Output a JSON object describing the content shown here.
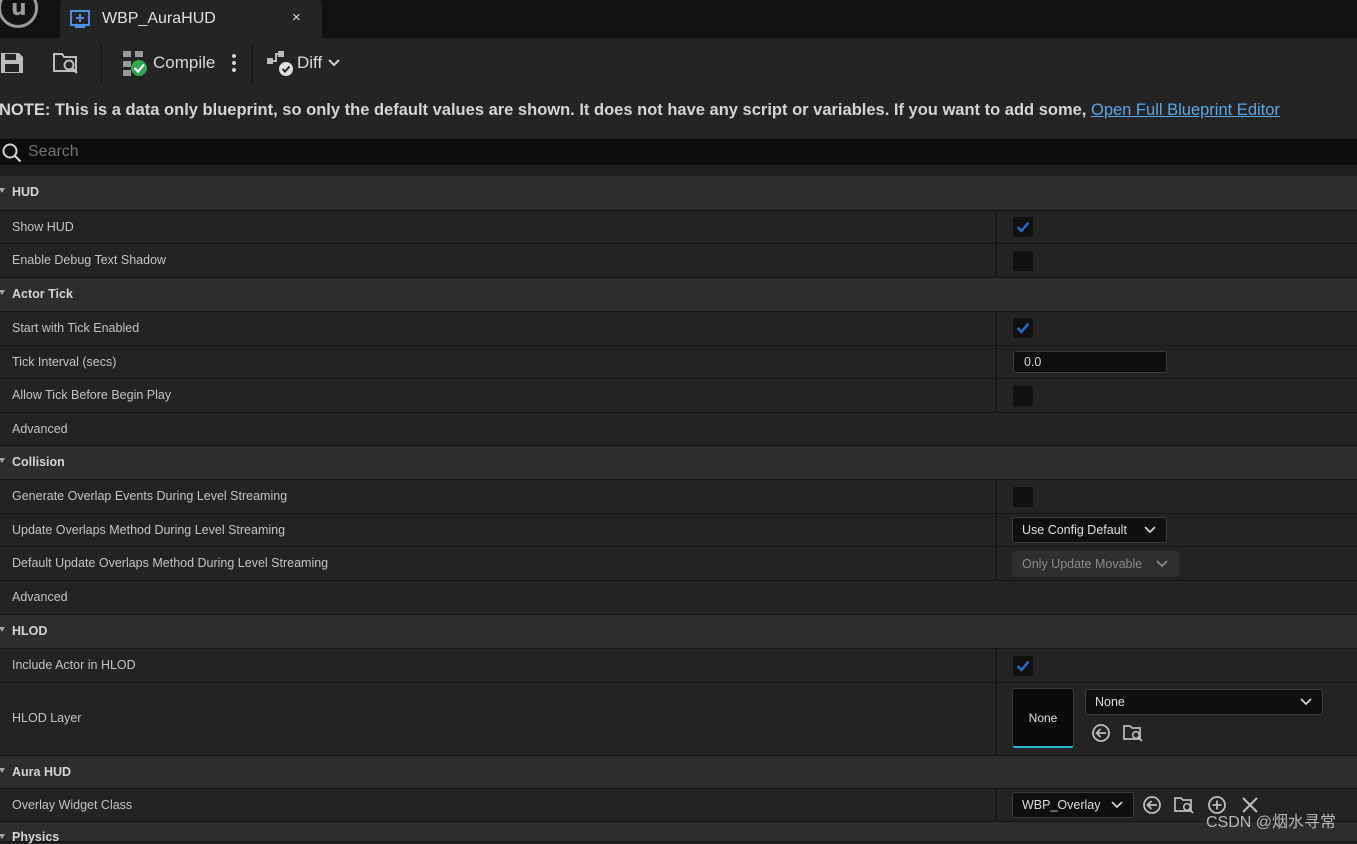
{
  "tab": {
    "title": "WBP_AuraHUD",
    "close": "×"
  },
  "toolbar": {
    "compile_label": "Compile",
    "diff_label": "Diff"
  },
  "note": {
    "text": "NOTE: This is a data only blueprint, so only the default values are shown.  It does not have any script or variables.  If you want to add some, ",
    "link": "Open Full Blueprint Editor"
  },
  "search": {
    "placeholder": "Search"
  },
  "categories": {
    "hud": "HUD",
    "actor_tick": "Actor Tick",
    "collision": "Collision",
    "hlod": "HLOD",
    "aura_hud": "Aura HUD",
    "physics": "Physics"
  },
  "props": {
    "show_hud": {
      "label": "Show HUD",
      "checked": true
    },
    "enable_debug_text_shadow": {
      "label": "Enable Debug Text Shadow",
      "checked": false
    },
    "start_with_tick_enabled": {
      "label": "Start with Tick Enabled",
      "checked": true
    },
    "tick_interval": {
      "label": "Tick Interval (secs)",
      "value": "0.0"
    },
    "allow_tick_before_begin_play": {
      "label": "Allow Tick Before Begin Play",
      "checked": false
    },
    "advanced_1": "Advanced",
    "generate_overlap_events": {
      "label": "Generate Overlap Events During Level Streaming",
      "checked": false
    },
    "update_overlaps_method": {
      "label": "Update Overlaps Method During Level Streaming",
      "value": "Use Config Default"
    },
    "default_update_overlaps_method": {
      "label": "Default Update Overlaps Method During Level Streaming",
      "value": "Only Update Movable"
    },
    "advanced_2": "Advanced",
    "include_actor_in_hlod": {
      "label": "Include Actor in HLOD",
      "checked": true
    },
    "hlod_layer": {
      "label": "HLOD Layer",
      "thumbnail": "None",
      "value": "None"
    },
    "overlay_widget_class": {
      "label": "Overlay Widget Class",
      "value": "WBP_Overlay"
    }
  },
  "watermark": "CSDN @烟水寻常",
  "colors": {
    "accent_blue": "#1f6fd1",
    "link": "#5aa7e8",
    "thumb_underline": "#2ab7d6"
  }
}
